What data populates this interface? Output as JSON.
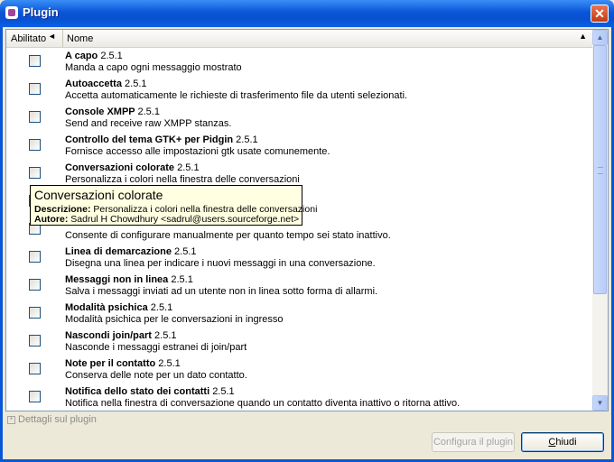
{
  "window": {
    "title": "Plugin",
    "close_glyph": "✕"
  },
  "header": {
    "abilitato": "Abilitato",
    "abilitato_arrow": "◄",
    "nome": "Nome",
    "nome_arrow": "▲"
  },
  "plugins": [
    {
      "name": "A capo",
      "version": "2.5.1",
      "description": "Manda a capo ogni messaggio mostrato"
    },
    {
      "name": "Autoaccetta",
      "version": "2.5.1",
      "description": "Accetta automaticamente le richieste di trasferimento file da utenti selezionati."
    },
    {
      "name": "Console XMPP",
      "version": "2.5.1",
      "description": "Send and receive raw XMPP stanzas."
    },
    {
      "name": "Controllo del tema GTK+ per Pidgin",
      "version": "2.5.1",
      "description": "Fornisce accesso alle impostazioni gtk usate comunemente."
    },
    {
      "name": "Conversazioni colorate",
      "version": "2.5.1",
      "description": "Personalizza i colori nella finestra delle conversazioni"
    },
    {
      "name": "",
      "version": "",
      "description": ""
    },
    {
      "name": "",
      "version": "",
      "description": "Consente di configurare manualmente per quanto tempo sei stato inattivo."
    },
    {
      "name": "Linea di demarcazione",
      "version": "2.5.1",
      "description": "Disegna una linea per indicare i nuovi messaggi in una conversazione."
    },
    {
      "name": "Messaggi non in linea",
      "version": "2.5.1",
      "description": "Salva i messaggi inviati ad un utente non in linea sotto forma di allarmi."
    },
    {
      "name": "Modalità psichica",
      "version": "2.5.1",
      "description": "Modalità psichica per le conversazioni in ingresso"
    },
    {
      "name": "Nascondi join/part",
      "version": "2.5.1",
      "description": "Nasconde i messaggi estranei di join/part"
    },
    {
      "name": "Note per il contatto",
      "version": "2.5.1",
      "description": "Conserva delle note per un dato contatto."
    },
    {
      "name": "Notifica dello stato dei contatti",
      "version": "2.5.1",
      "description": "Notifica nella finestra di conversazione quando un contatto diventa inattivo o ritorna attivo."
    }
  ],
  "tooltip": {
    "title": "Conversazioni colorate",
    "desc_label": "Descrizione:",
    "desc_value": "Personalizza i colori nella finestra delle conversazioni",
    "author_label": "Autore:",
    "author_value": "Sadrul H Chowdhury <sadrul@users.sourceforge.net>"
  },
  "details": {
    "label": "Dettagli sul plugin",
    "glyph": "+"
  },
  "buttons": {
    "configure": "Configura il plugin",
    "close": "Chiudi"
  }
}
